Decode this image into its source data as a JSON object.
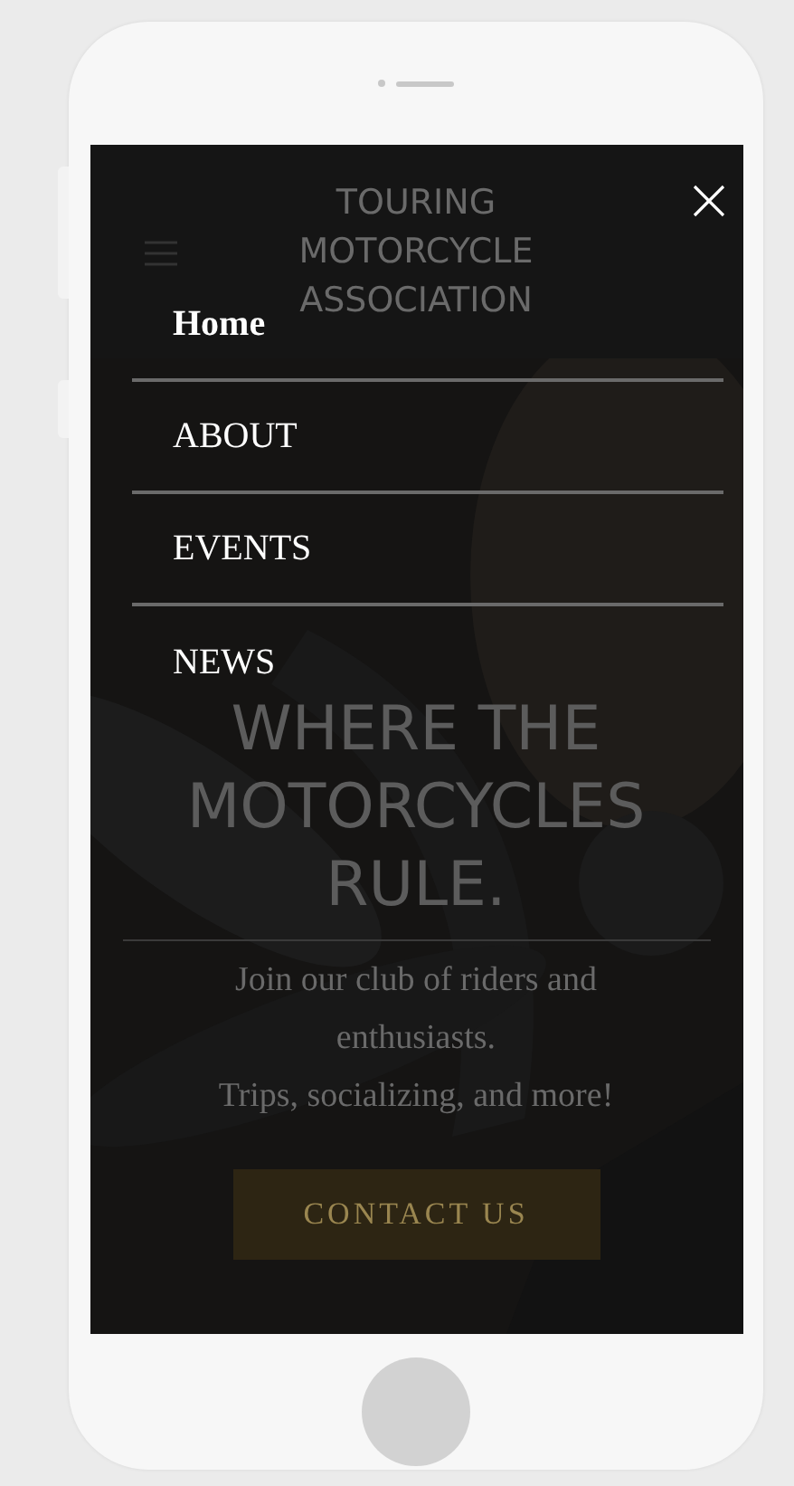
{
  "header": {
    "title_lines": [
      "TOURING",
      "MOTORCYCLE",
      "ASSOCIATION"
    ]
  },
  "menu": {
    "items": [
      {
        "label": "Home",
        "selected": true
      },
      {
        "label": "ABOUT",
        "selected": false
      },
      {
        "label": "EVENTS",
        "selected": false
      },
      {
        "label": "NEWS",
        "selected": false
      }
    ]
  },
  "hero": {
    "kind": "picture",
    "headline_lines": [
      "WHERE THE",
      "MOTORCYCLES",
      "RULE."
    ],
    "tagline_lines": [
      "Join our club of riders and",
      "enthusiasts.",
      "Trips, socializing, and more!"
    ],
    "button": "CONTACT US"
  }
}
